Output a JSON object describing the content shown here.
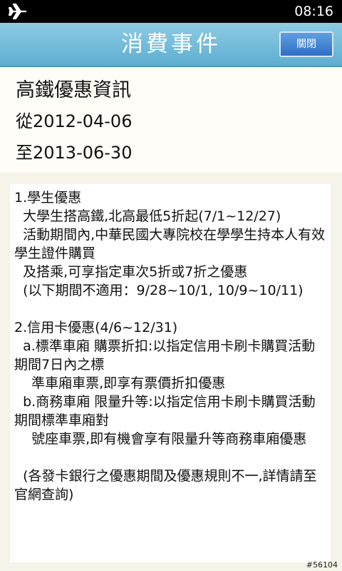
{
  "status_bar": {
    "time": "08:16",
    "icon": "airplane-icon"
  },
  "header": {
    "title": "消費事件",
    "close_label": "關閉",
    "colors": {
      "bar_top": "#8fcbe3",
      "bar_bottom": "#5daed2",
      "button": "#2f6fc4"
    }
  },
  "event": {
    "name": "高鐵優惠資訊",
    "from": "從2012-04-06",
    "to": "至2013-06-30"
  },
  "content": {
    "text": "1.學生優惠\n  大學生搭高鐵,北高最低5折起(7/1~12/27)\n  活動期間內,中華民國大專院校在學學生持本人有效學生證件購買\n  及搭乘,可享指定車次5折或7折之優惠\n  (以下期間不適用：9/28~10/1, 10/9~10/11)\n\n2.信用卡優惠(4/6~12/31)\n  a.標準車廂 購票折扣:以指定信用卡刷卡購買活動期間7日內之標\n    準車廂車票,即享有票價折扣優惠\n  b.商務車廂 限量升等:以指定信用卡刷卡購買活動期間標準車廂對\n    號座車票,即有機會享有限量升等商務車廂優惠\n\n  (各發卡銀行之優惠期間及優惠規則不一,詳情請至官網查詢)"
  },
  "watermark": "#56104"
}
